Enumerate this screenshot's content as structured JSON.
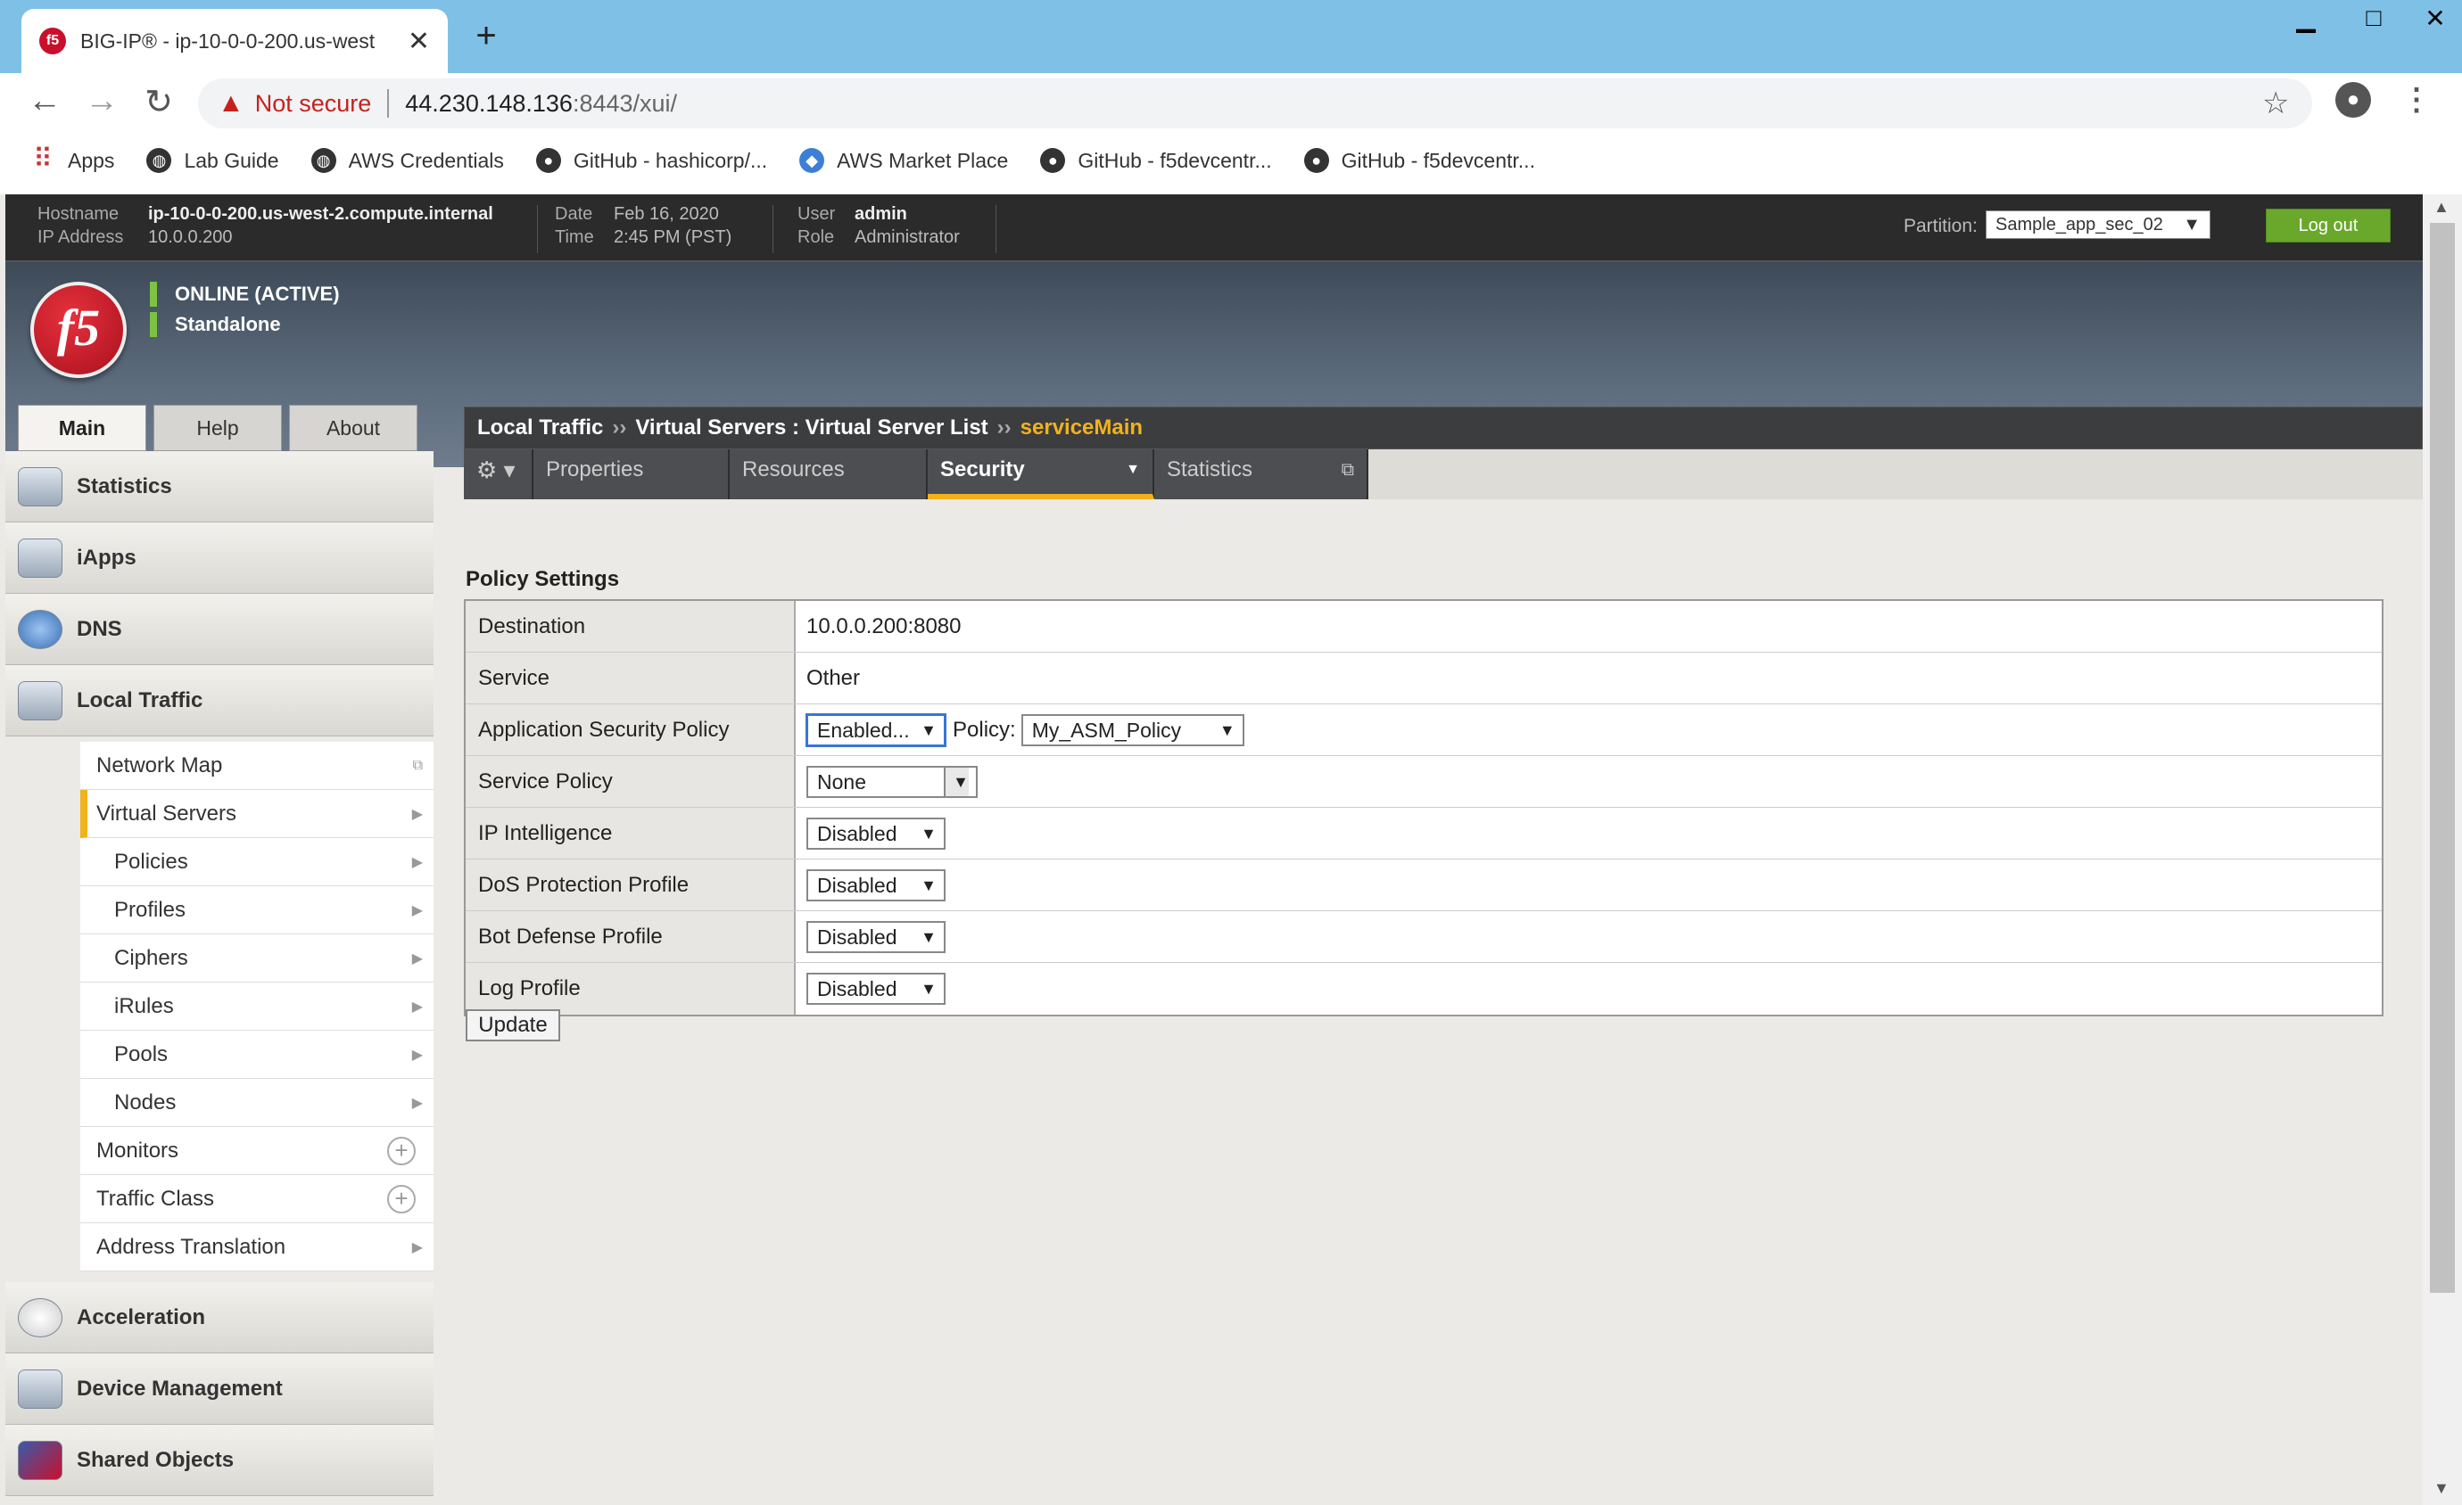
{
  "browser": {
    "tab_title": "BIG-IP® - ip-10-0-0-200.us-west",
    "tab_close": "✕",
    "new_tab": "+",
    "not_secure": "Not secure",
    "url_host": "44.230.148.136",
    "url_rest": ":8443/xui/",
    "bookmarks": [
      "Apps",
      "Lab Guide",
      "AWS Credentials",
      "GitHub - hashicorp/...",
      "AWS Market Place",
      "GitHub - f5devcentr...",
      "GitHub - f5devcentr..."
    ]
  },
  "banner": {
    "hostname_label": "Hostname",
    "hostname": "ip-10-0-0-200.us-west-2.compute.internal",
    "ip_label": "IP Address",
    "ip": "10.0.0.200",
    "date_label": "Date",
    "date": "Feb 16, 2020",
    "time_label": "Time",
    "time": "2:45 PM (PST)",
    "user_label": "User",
    "user": "admin",
    "role_label": "Role",
    "role": "Administrator",
    "partition_label": "Partition:",
    "partition": "Sample_app_sec_02",
    "logout": "Log out"
  },
  "header": {
    "logo": "f5",
    "status1": "ONLINE (ACTIVE)",
    "status2": "Standalone"
  },
  "main_tabs": [
    "Main",
    "Help",
    "About"
  ],
  "sidebar": {
    "sections_top": [
      "Statistics",
      "iApps",
      "DNS",
      "Local Traffic"
    ],
    "local_traffic_items": [
      "Network Map",
      "Virtual Servers",
      "Policies",
      "Profiles",
      "Ciphers",
      "iRules",
      "Pools",
      "Nodes",
      "Monitors",
      "Traffic Class",
      "Address Translation"
    ],
    "sections_bottom": [
      "Acceleration",
      "Device Management",
      "Shared Objects"
    ]
  },
  "breadcrumb": {
    "part1": "Local Traffic",
    "part2": "Virtual Servers : Virtual Server List",
    "current": "serviceMain",
    "separator": "››"
  },
  "tabs": [
    "Properties",
    "Resources",
    "Security",
    "Statistics"
  ],
  "policy_settings": {
    "title": "Policy Settings",
    "rows": [
      {
        "label": "Destination",
        "value": "10.0.0.200:8080"
      },
      {
        "label": "Service",
        "value": "Other"
      },
      {
        "label": "Application Security Policy",
        "select": "Enabled...",
        "policy_label": "Policy:",
        "policy": "My_ASM_Policy"
      },
      {
        "label": "Service Policy",
        "select": "None"
      },
      {
        "label": "IP Intelligence",
        "select": "Disabled"
      },
      {
        "label": "DoS Protection Profile",
        "select": "Disabled"
      },
      {
        "label": "Bot Defense Profile",
        "select": "Disabled"
      },
      {
        "label": "Log Profile",
        "select": "Disabled"
      }
    ],
    "update_button": "Update"
  },
  "colors": {
    "accent": "#f2b21c",
    "logout": "#6aa82c",
    "online": "#7dc242"
  }
}
